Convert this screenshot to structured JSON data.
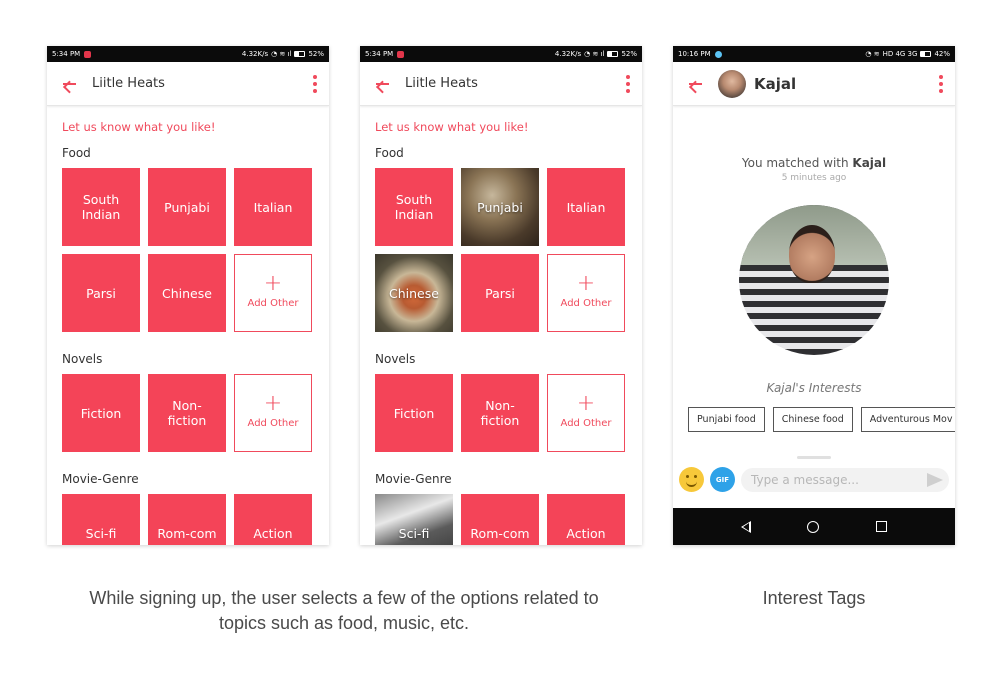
{
  "screen1": {
    "status": {
      "time": "5:34 PM",
      "speed": "4.32K/s",
      "battery": "52%"
    },
    "title": "Liitle Heats",
    "prompt": "Let us know what you like!",
    "sections": {
      "food": {
        "title": "Food",
        "tiles": [
          "South Indian",
          "Punjabi",
          "Italian",
          "Parsi",
          "Chinese"
        ],
        "add": "Add Other"
      },
      "novels": {
        "title": "Novels",
        "tiles": [
          "Fiction",
          "Non-fiction"
        ],
        "add": "Add Other"
      },
      "movie": {
        "title": "Movie-Genre",
        "tiles": [
          "Sci-fi",
          "Rom-com",
          "Action"
        ]
      }
    }
  },
  "screen2": {
    "status": {
      "time": "5:34 PM",
      "speed": "4.32K/s",
      "battery": "52%"
    },
    "title": "Liitle Heats",
    "prompt": "Let us know what you like!",
    "sections": {
      "food": {
        "title": "Food",
        "tiles": [
          "South Indian",
          "Punjabi",
          "Italian",
          "Chinese",
          "Parsi"
        ],
        "add": "Add Other"
      },
      "novels": {
        "title": "Novels",
        "tiles": [
          "Fiction",
          "Non-fiction"
        ],
        "add": "Add Other"
      },
      "movie": {
        "title": "Movie-Genre",
        "tiles": [
          "Sci-fi",
          "Rom-com",
          "Action"
        ]
      }
    }
  },
  "screen3": {
    "status": {
      "time": "10:16 PM",
      "network": "HD 4G 3G",
      "battery": "42%"
    },
    "name": "Kajal",
    "matched_prefix": "You matched with ",
    "matched_name": "Kajal",
    "ago": "5 minutes ago",
    "interests_title": "Kajal's Interests",
    "tags": [
      "Punjabi food",
      "Chinese food",
      "Adventurous Mov"
    ],
    "composer_placeholder": "Type a message...",
    "gif_label": "GIF"
  },
  "captions": {
    "left": "While signing up, the user selects a few of the options related to topics such as food, music, etc.",
    "right": "Interest Tags"
  },
  "colors": {
    "accent": "#f44458",
    "accent_text": "#f04a5c"
  }
}
